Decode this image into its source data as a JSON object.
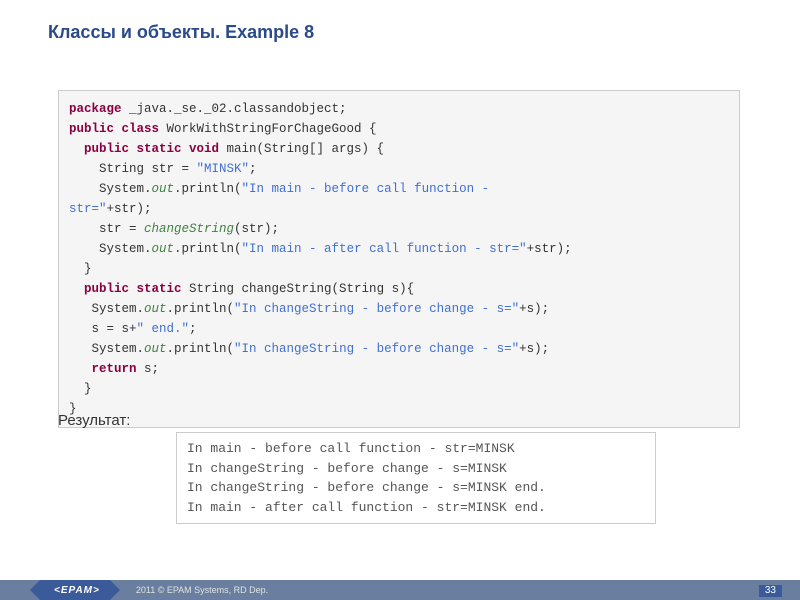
{
  "title": "Классы и объекты. Example 8",
  "code": {
    "l1a": "package",
    "l1b": " _java._se._02.classandobject;",
    "l2a": "public class",
    "l2b": " WorkWithStringForChageGood {",
    "l3a": "  public static void",
    "l3b": " main(String[] args) {",
    "l4a": "    String str = ",
    "l4b": "\"MINSK\"",
    "l4c": ";",
    "l5a": "    System.",
    "l5b": "out",
    "l5c": ".println(",
    "l5d": "\"In main - before call function -\nstr=\"",
    "l5e": "+str);",
    "l6a": "    str = ",
    "l6b": "changeString",
    "l6c": "(str);",
    "l7a": "    System.",
    "l7b": "out",
    "l7c": ".println(",
    "l7d": "\"In main - after call function - str=\"",
    "l7e": "+str);",
    "l8": "  }",
    "l9a": "  public static",
    "l9b": " String changeString(String s){",
    "l10a": "   System.",
    "l10b": "out",
    "l10c": ".println(",
    "l10d": "\"In changeString - before change - s=\"",
    "l10e": "+s);",
    "l11a": "   s = s+",
    "l11b": "\" end.\"",
    "l11c": ";",
    "l12a": "   System.",
    "l12b": "out",
    "l12c": ".println(",
    "l12d": "\"In changeString - before change - s=\"",
    "l12e": "+s);",
    "l13a": "   return",
    "l13b": " s;",
    "l14": "  }",
    "l15": "}"
  },
  "result_label": "Результат:",
  "output": "In main - before call function - str=MINSK\nIn changeString - before change - s=MINSK\nIn changeString - before change - s=MINSK end.\nIn main - after call function - str=MINSK end.",
  "footer": {
    "brand": "<EPAM>",
    "copyright": "2011 © EPAM Systems, RD Dep.",
    "page": "33"
  }
}
